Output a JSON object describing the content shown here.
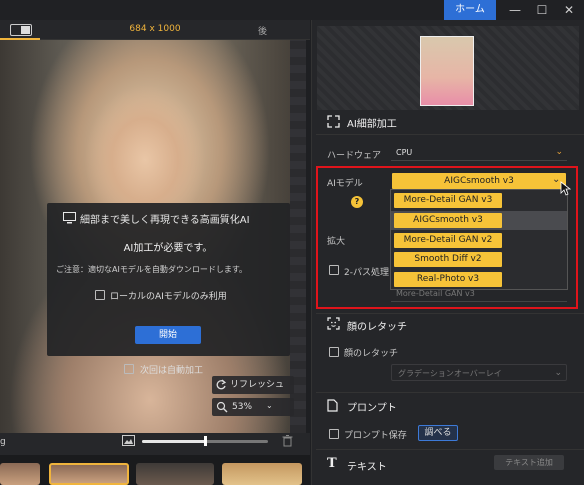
{
  "titlebar": {
    "home_label": "ホーム",
    "minimize": "—",
    "maximize": "☐",
    "close": "✕"
  },
  "viewer": {
    "dimensions": "684 x 1000",
    "after_label": "後",
    "dialog": {
      "title": "細部まで美しく再現できる高画質化AI",
      "heading": "AI加工が必要です。",
      "note": "ご注意：適切なAIモデルを自動ダウンロードします。",
      "checkbox_label": "ローカルのAIモデルのみ利用",
      "start_label": "開始"
    },
    "auto_checkbox_label": "次回は自動加工",
    "refresh_label": "リフレッシュ",
    "zoom_label": "53%",
    "file_tab_text": "g"
  },
  "panel": {
    "ai_section_title": "AI細部加工",
    "hardware_label": "ハードウェア",
    "hardware_value": "CPU",
    "ai_model_label": "AIモデル",
    "ai_model_value": "AIGCsmooth  v3",
    "model_options": [
      "More-Detail GAN  v3",
      "AIGCsmooth  v3",
      "More-Detail GAN  v2",
      "Smooth Diff  v2",
      "Real-Photo  v3"
    ],
    "highlighted_option": "AIGCsmooth  v3",
    "help_icon": "?",
    "upscale_label": "拡大",
    "twopass_label": "2-パス処理",
    "twopass_value": "More-Detail GAN  v3",
    "face_section_title": "顔のレタッチ",
    "face_checkbox_label": "顔のレタッチ",
    "face_select_value": "グラデーションオーバーレイ",
    "prompt_section_title": "プロンプト",
    "prompt_save_label": "プロンプト保存",
    "prompt_check_label": "調べる",
    "text_section_title": "テキスト",
    "text_add_label": "テキスト追加"
  },
  "colors": {
    "accent": "#f6c338",
    "blue": "#2d6fd6",
    "highlight_box": "#e0141b"
  }
}
